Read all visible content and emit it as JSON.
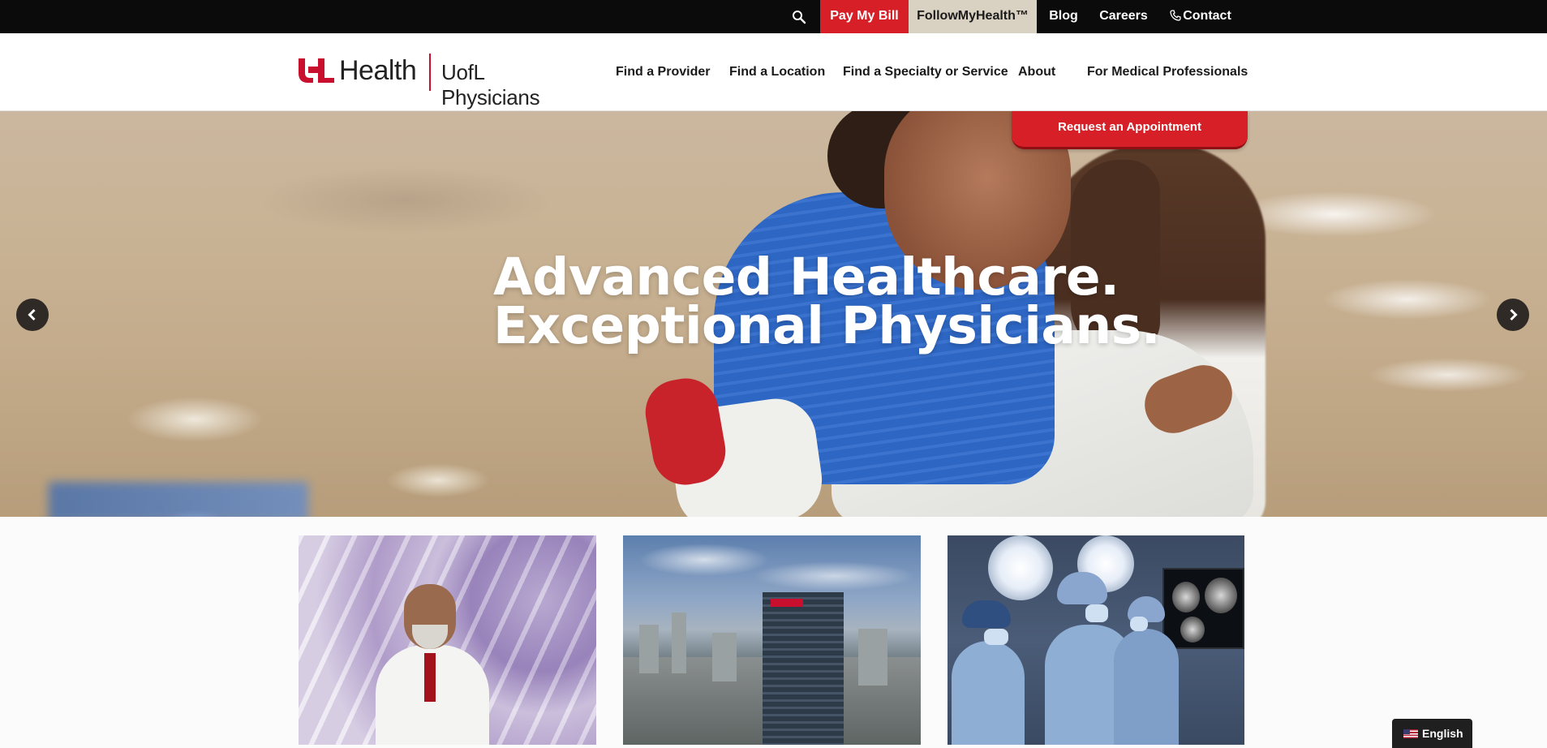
{
  "topbar": {
    "search_icon": "search-icon",
    "pay_bill": "Pay My Bill",
    "follow_my_health": "FollowMyHealth™",
    "blog": "Blog",
    "careers": "Careers",
    "contact": "Contact",
    "contact_icon": "phone-icon",
    "colors": {
      "bar": "#0b0b0b",
      "pay_bill": "#d61f26",
      "follow_my_health": "#d9d1c2"
    }
  },
  "header": {
    "logo": {
      "brand": "Health",
      "mark": "UL",
      "subbrand": "UofL Physicians"
    },
    "nav": {
      "find_provider": "Find a Provider",
      "find_location": "Find a Location",
      "find_specialty": "Find a Specialty or Service",
      "about": "About",
      "medical_professionals": "For Medical Professionals"
    }
  },
  "hero": {
    "headline_line1": "Advanced Healthcare.",
    "headline_line2": "Exceptional Physicians.",
    "request_appointment": "Request an Appointment",
    "prev_icon": "chevron-left-icon",
    "next_icon": "chevron-right-icon",
    "accent_color": "#d61f26"
  },
  "cards": [
    {
      "image": "physician-portrait"
    },
    {
      "image": "uofl-health-tower-skyline"
    },
    {
      "image": "surgical-team-operating-room"
    }
  ],
  "language_selector": {
    "label": "English",
    "flag_icon": "us-flag-icon"
  }
}
